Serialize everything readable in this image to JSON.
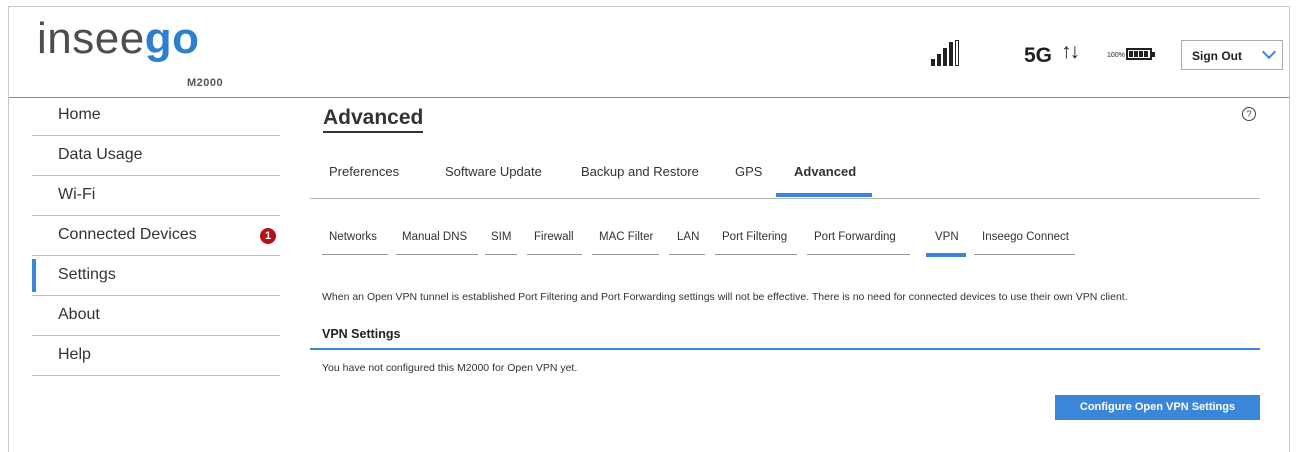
{
  "header": {
    "brand_part1": "insee",
    "brand_part2": "go",
    "model": "M2000",
    "network": "5G",
    "transfer_arrows": "↑↓",
    "battery_percent": "100%",
    "sign_out_label": "Sign Out"
  },
  "sidebar": {
    "items": [
      {
        "label": "Home"
      },
      {
        "label": "Data Usage"
      },
      {
        "label": "Wi-Fi"
      },
      {
        "label": "Connected Devices",
        "badge": "1"
      },
      {
        "label": "Settings",
        "active": true
      },
      {
        "label": "About"
      },
      {
        "label": "Help"
      }
    ]
  },
  "main": {
    "title": "Advanced",
    "help_icon": "?",
    "tabs": [
      {
        "label": "Preferences"
      },
      {
        "label": "Software Update"
      },
      {
        "label": "Backup and Restore"
      },
      {
        "label": "GPS"
      },
      {
        "label": "Advanced",
        "active": true
      }
    ],
    "subtabs": [
      {
        "label": "Networks"
      },
      {
        "label": "Manual DNS"
      },
      {
        "label": "SIM"
      },
      {
        "label": "Firewall"
      },
      {
        "label": "MAC Filter"
      },
      {
        "label": "LAN"
      },
      {
        "label": "Port Filtering"
      },
      {
        "label": "Port Forwarding"
      },
      {
        "label": "VPN",
        "active": true
      },
      {
        "label": "Inseego Connect"
      }
    ],
    "info_text": "When an Open VPN tunnel is established Port Filtering and Port Forwarding settings will not be effective. There is no need for connected devices to use their own VPN client.",
    "section_title": "VPN Settings",
    "status_text": "You have not configured this M2000 for Open VPN yet.",
    "configure_button": "Configure Open VPN Settings"
  },
  "colors": {
    "accent": "#3a86d8",
    "badge": "#b0121b",
    "brand_gray": "#4d4d4d"
  },
  "icons": [
    "signal-icon",
    "battery-icon",
    "chevron-down-icon",
    "help-icon",
    "notification-badge"
  ]
}
